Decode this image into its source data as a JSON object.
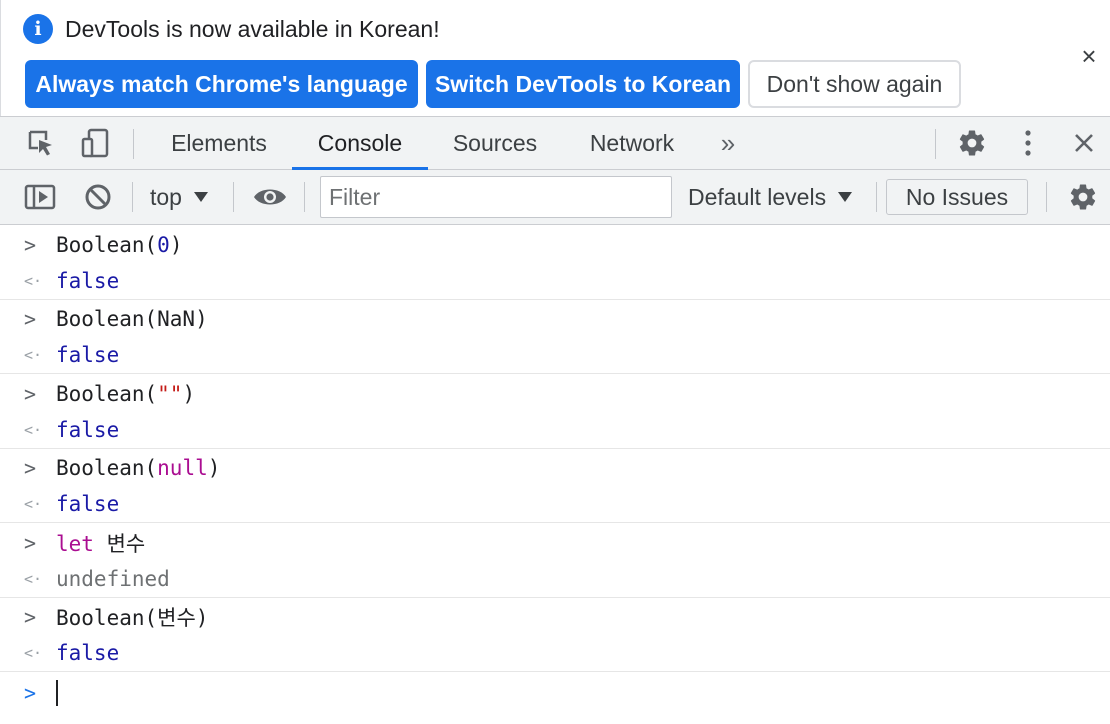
{
  "infobar": {
    "message": "DevTools is now available in Korean!",
    "info_icon": "info-icon",
    "buttons": {
      "match_language": "Always match Chrome's language",
      "switch_korean": "Switch DevTools to Korean",
      "dont_show": "Don't show again"
    },
    "close_glyph": "×"
  },
  "tabs": {
    "items": [
      "Elements",
      "Console",
      "Sources",
      "Network"
    ],
    "active": "Console",
    "more_glyph": "»"
  },
  "console_toolbar": {
    "context": "top",
    "filter_placeholder": "Filter",
    "levels": "Default levels",
    "issues": "No Issues"
  },
  "console": {
    "entries": [
      {
        "type": "input",
        "parts": [
          {
            "t": "Boolean(",
            "c": "plain"
          },
          {
            "t": "0",
            "c": "num"
          },
          {
            "t": ")",
            "c": "plain"
          }
        ]
      },
      {
        "type": "output",
        "parts": [
          {
            "t": "false",
            "c": "val"
          }
        ]
      },
      {
        "type": "input",
        "parts": [
          {
            "t": "Boolean(NaN)",
            "c": "plain"
          }
        ]
      },
      {
        "type": "output",
        "parts": [
          {
            "t": "false",
            "c": "val"
          }
        ]
      },
      {
        "type": "input",
        "parts": [
          {
            "t": "Boolean(",
            "c": "plain"
          },
          {
            "t": "\"\"",
            "c": "str"
          },
          {
            "t": ")",
            "c": "plain"
          }
        ]
      },
      {
        "type": "output",
        "parts": [
          {
            "t": "false",
            "c": "val"
          }
        ]
      },
      {
        "type": "input",
        "parts": [
          {
            "t": "Boolean(",
            "c": "plain"
          },
          {
            "t": "null",
            "c": "kw"
          },
          {
            "t": ")",
            "c": "plain"
          }
        ]
      },
      {
        "type": "output",
        "parts": [
          {
            "t": "false",
            "c": "val"
          }
        ]
      },
      {
        "type": "input",
        "parts": [
          {
            "t": "let",
            "c": "kw"
          },
          {
            "t": " 변수",
            "c": "plain"
          }
        ]
      },
      {
        "type": "output",
        "parts": [
          {
            "t": "undefined",
            "c": "undef"
          }
        ]
      },
      {
        "type": "input",
        "parts": [
          {
            "t": "Boolean(변수)",
            "c": "plain"
          }
        ]
      },
      {
        "type": "output",
        "parts": [
          {
            "t": "false",
            "c": "val"
          }
        ]
      }
    ],
    "input_arrow": ">",
    "output_arrow": "<·",
    "prompt_arrow": ">"
  },
  "colors": {
    "accent": "#1a73e8",
    "number": "#1a1aa6",
    "string": "#c41a16",
    "keyword": "#aa0d91",
    "undefined": "#6e7173"
  }
}
